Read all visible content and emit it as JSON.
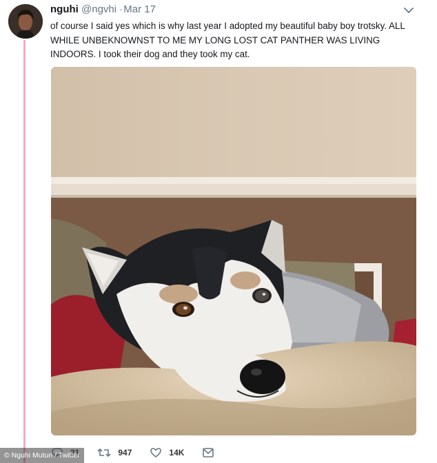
{
  "tweet": {
    "name": "nguhi",
    "handle": "@ngvhi",
    "separator": "·",
    "time": "Mar 17",
    "text": "of course I said yes which is why last year I adopted my beautiful baby boy trotsky. ALL WHILE UNBEKNOWNST TO ME MY LONG LOST CAT PANTHER WAS LIVING INDOORS. I took their dog and they took my cat."
  },
  "actions": {
    "replies": "21",
    "retweets": "947",
    "likes": "14K"
  },
  "credit": "© Nguhi Muturi / Twitter",
  "colors": {
    "thread_line": "#f4a9c4",
    "text": "#14171a",
    "muted": "#657786"
  },
  "icons": [
    "reply-icon",
    "retweet-icon",
    "like-icon",
    "message-icon",
    "chevron-down-icon"
  ]
}
